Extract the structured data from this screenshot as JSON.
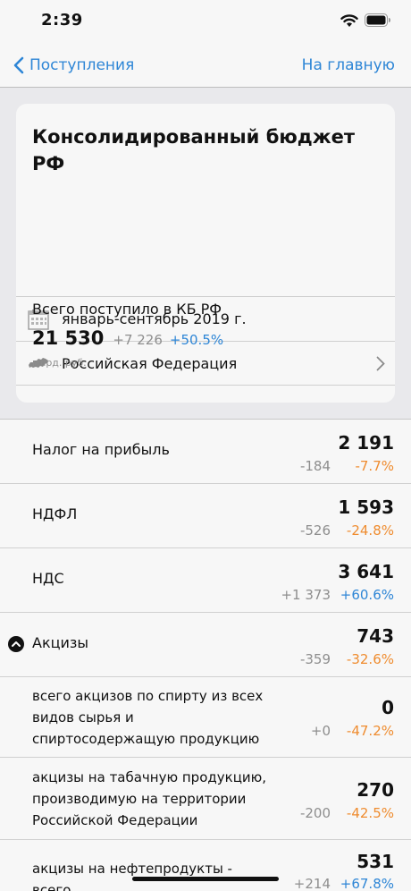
{
  "status": {
    "time": "2:39"
  },
  "nav": {
    "back_label": "Поступления",
    "home_label": "На главную"
  },
  "card": {
    "title": "Консолидированный бюджет РФ",
    "period": "январь-сентябрь 2019 г.",
    "region": "Российская Федерация",
    "total_label": "Всего поступило в КБ РФ",
    "total_value": "21 530",
    "total_abs": "+7 226",
    "total_pct": "+50.5%",
    "total_unit": "млрд. руб."
  },
  "colors": {
    "accent": "#2e86d6",
    "negative": "#ef8c2f",
    "muted": "#8e8e8e"
  },
  "taxes": [
    {
      "name": "Налог на прибыль",
      "value": "2 191",
      "abs": "-184",
      "pct": "-7.7%",
      "trend": "negative"
    },
    {
      "name": "НДФЛ",
      "value": "1 593",
      "abs": "-526",
      "pct": "-24.8%",
      "trend": "negative"
    },
    {
      "name": "НДС",
      "value": "3 641",
      "abs": "+1 373",
      "pct": "+60.6%",
      "trend": "positive"
    },
    {
      "name": "Акцизы",
      "value": "743",
      "abs": "-359",
      "pct": "-32.6%",
      "trend": "negative",
      "expanded": true
    },
    {
      "name": "всего акцизов по спирту из всех видов сырья и спиртосодержащую продукцию",
      "value": "0",
      "abs": "+0",
      "pct": "-47.2%",
      "trend": "negative"
    },
    {
      "name": "акцизы на табачную продукцию, производимую на территории Российской Федерации",
      "value": "270",
      "abs": "-200",
      "pct": "-42.5%",
      "trend": "negative"
    },
    {
      "name": "акцизы на нефтепродукты - всего",
      "value": "531",
      "abs": "+214",
      "pct": "+67.8%",
      "trend": "positive"
    }
  ]
}
